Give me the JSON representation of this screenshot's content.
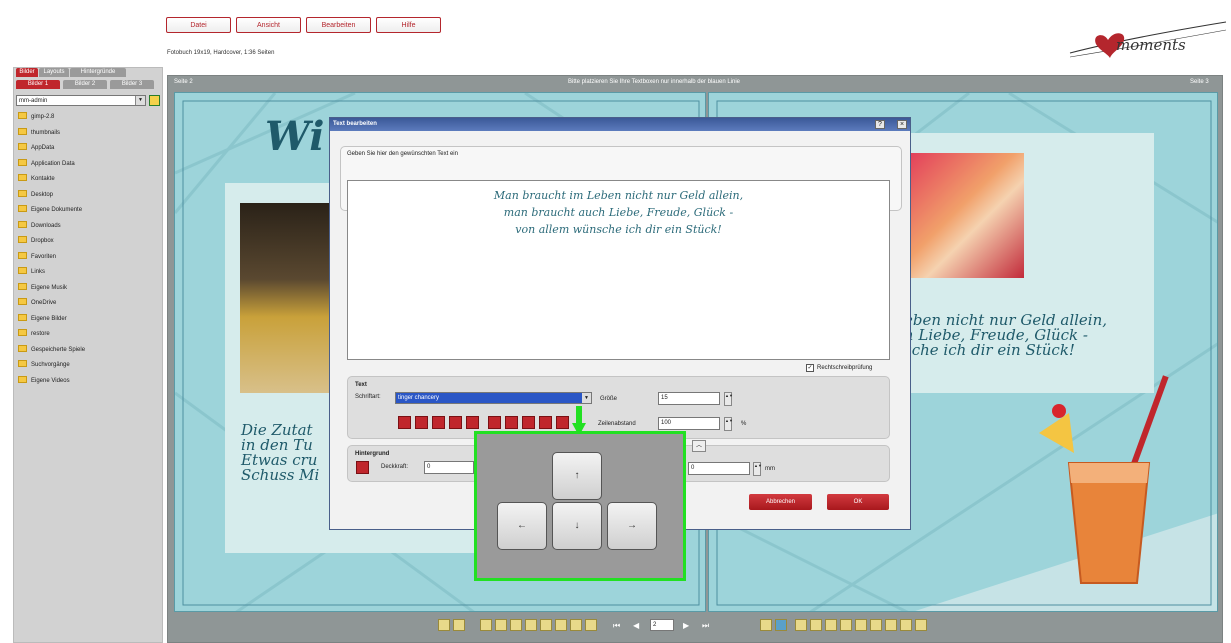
{
  "menu": [
    "Datei",
    "Ansicht",
    "Bearbeiten",
    "Hilfe"
  ],
  "info_line": "Fotobuch 19x19, Hardcover, 1:36 Seiten",
  "logo": "moments",
  "left_tabs": [
    "Bilder",
    "Layouts",
    "Hintergründe"
  ],
  "sub_tabs": [
    "Bilder 1",
    "Bilder 2",
    "Bilder 3"
  ],
  "folder_select": "mm-admin",
  "folders": [
    "gimp-2.8",
    "thumbnails",
    "AppData",
    "Application Data",
    "Kontakte",
    "Desktop",
    "Eigene Dokumente",
    "Downloads",
    "Dropbox",
    "Favoriten",
    "Links",
    "Eigene Musik",
    "OneDrive",
    "Eigene Bilder",
    "restore",
    "Gespeicherte Spiele",
    "Suchvorgänge",
    "Eigene Videos"
  ],
  "page_left_label": "Seite 2",
  "page_right_label": "Seite 3",
  "hint": "Bitte platzieren Sie Ihre Textboxen nur innerhalb der blauen Linie",
  "page_left_title": "Wi",
  "page_left_text": [
    "Die Zutat",
    "in den Tu",
    "Etwas cru",
    "Schuss Mi"
  ],
  "page_right_text": [
    "eben nicht nur Geld allein,",
    "h Liebe, Freude, Glück -",
    "sche ich dir ein Stück!"
  ],
  "dialog": {
    "title": "Text bearbeiten",
    "prompt": "Geben Sie hier den gewünschten Text ein",
    "text_lines": [
      "Man braucht im Leben nicht nur Geld allein,",
      "man braucht auch Liebe, Freude, Glück -",
      "von allem wünsche ich dir ein Stück!"
    ],
    "spellcheck": "Rechtschreibprüfung",
    "text_group": "Text",
    "font_label": "Schriftart:",
    "font_value": "tinger chancery",
    "size_label": "Größe",
    "size_value": "15",
    "linespacing_label": "Zeilenabstand",
    "linespacing_value": "100",
    "percent": "%",
    "bg_group": "Hintergrund",
    "opacity_label": "Deckkraft:",
    "opacity_value": "0",
    "margin_value": "0",
    "mm": "mm",
    "cancel": "Abbrechen",
    "ok": "OK"
  },
  "keys": {
    "up": "↑",
    "left": "←",
    "down": "↓",
    "right": "→"
  },
  "page_number": "2",
  "colors": {
    "accent_red": "#b4262d",
    "page_teal": "#9dd4da",
    "highlight_green": "#22e022",
    "title_blue": "#3b5998"
  }
}
